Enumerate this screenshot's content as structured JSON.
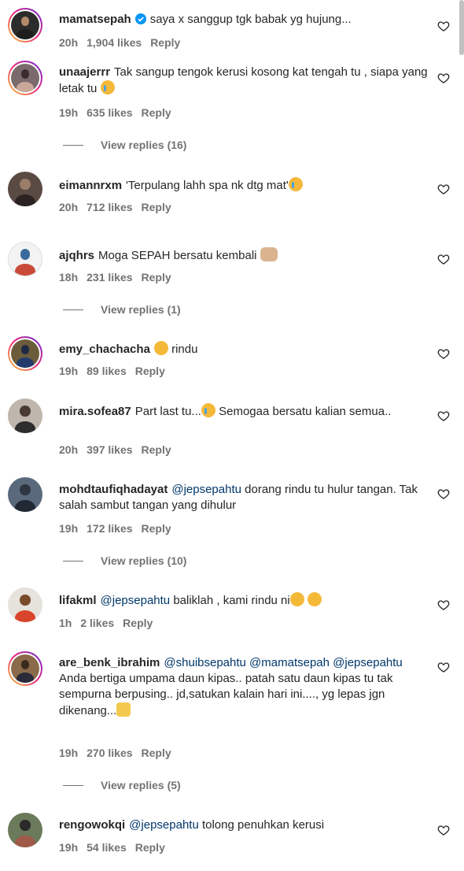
{
  "comments": [
    {
      "username": "mamatsepah",
      "verified": true,
      "mention": "",
      "text": "saya x sanggup tgk babak yg hujung...",
      "emoji": "",
      "time": "20h",
      "likes": "1,904 likes",
      "reply": "Reply",
      "view_replies": "",
      "ring": "story"
    },
    {
      "username": "unaajerrr",
      "verified": false,
      "mention": "",
      "text": "Tak sangup tengok kerusi kosong kat tengah tu , siapa yang letak tu",
      "emoji": "cry",
      "time": "19h",
      "likes": "635 likes",
      "reply": "Reply",
      "view_replies": "View replies (16)",
      "ring": "story"
    },
    {
      "username": "eimannrxm",
      "verified": false,
      "mention": "",
      "text": "'Terpulang lahh spa nk dtg mat'",
      "emoji": "cry",
      "time": "20h",
      "likes": "712 likes",
      "reply": "Reply",
      "view_replies": "",
      "ring": "plain"
    },
    {
      "username": "ajqhrs",
      "verified": false,
      "mention": "",
      "text": "Moga SEPAH bersatu kembali",
      "emoji": "hands",
      "time": "18h",
      "likes": "231 likes",
      "reply": "Reply",
      "view_replies": "View replies (1)",
      "ring": "plain"
    },
    {
      "username": "emy_chachacha",
      "verified": false,
      "mention": "",
      "text": "rindu",
      "emoji_before": "plead",
      "emoji": "",
      "time": "19h",
      "likes": "89 likes",
      "reply": "Reply",
      "view_replies": "",
      "ring": "story"
    },
    {
      "username": "mira.sofea87",
      "verified": false,
      "mention": "",
      "text": "Part last tu...",
      "emoji": "cry",
      "text2": "Semogaa bersatu kalian semua..",
      "time": "20h",
      "likes": "397 likes",
      "reply": "Reply",
      "view_replies": "",
      "ring": "plain"
    },
    {
      "username": "mohdtaufiqhadayat",
      "verified": false,
      "mention": "@jepsepahtu",
      "text": "dorang rindu tu hulur tangan. Tak salah sambut tangan yang dihulur",
      "emoji": "",
      "time": "19h",
      "likes": "172 likes",
      "reply": "Reply",
      "view_replies": "View replies (10)",
      "ring": "plain"
    },
    {
      "username": "lifakml",
      "verified": false,
      "mention": "@jepsepahtu",
      "text": "baliklah , kami rindu ni",
      "emoji": "plead2",
      "time": "1h",
      "likes": "2 likes",
      "reply": "Reply",
      "view_replies": "",
      "ring": "plain"
    },
    {
      "username": "are_benk_ibrahim",
      "verified": false,
      "mention": "@shuibsepahtu @mamatsepah @jepsepahtu",
      "text": "Anda bertiga umpama daun kipas.. patah satu daun kipas tu tak sempurna berpusing.. jd,satukan kalain hari ini...., yg lepas jgn dikenang...",
      "emoji": "praise",
      "time": "19h",
      "likes": "270 likes",
      "reply": "Reply",
      "view_replies": "View replies (5)",
      "ring": "story"
    },
    {
      "username": "rengowokqi",
      "verified": false,
      "mention": "@jepsepahtu",
      "text": "tolong penuhkan kerusi",
      "emoji": "",
      "time": "19h",
      "likes": "54 likes",
      "reply": "Reply",
      "view_replies": "",
      "ring": "plain"
    }
  ],
  "colors": {
    "mention": "#00376b",
    "meta": "#737373",
    "text": "#262626"
  },
  "icons": {
    "like": "heart-icon",
    "verified": "verified-badge-icon"
  }
}
